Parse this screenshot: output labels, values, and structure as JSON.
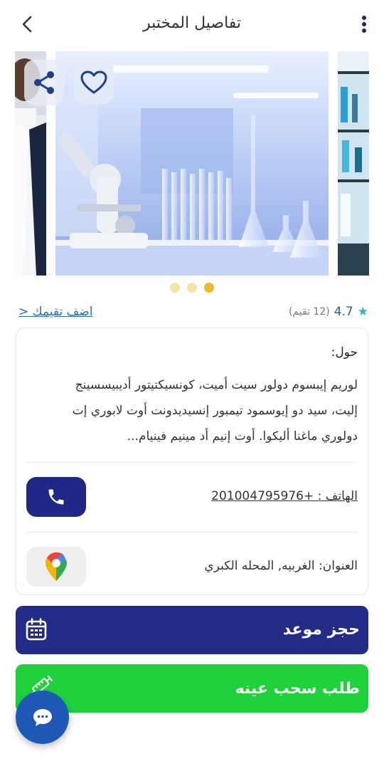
{
  "header": {
    "title": "تفاصيل المختبر",
    "back_icon": "chevron-left-icon",
    "menu_icon": "more-vertical-icon"
  },
  "gallery": {
    "image_count": 3,
    "active_index": 2,
    "images": [
      "lab-scientist-photo",
      "laboratory-equipment-photo",
      "lab-shelves-photo"
    ],
    "share_icon": "share-icon",
    "favorite_icon": "heart-icon"
  },
  "rating": {
    "value": "4.7",
    "count_text": "(12 تقيم)",
    "add_link": "اضف تقيمك <"
  },
  "details": {
    "about_label": "حول:",
    "about_lines": [
      "لوريم إيبسوم دولور سيت أميت، كونسيكتيتور أديبيسسينج",
      "إليت، سيد دو إيوسمود تيمبور إنسيديدونت أوت لابوري إت",
      "دولوري ماغنا أليكوا. أوت إنيم أد مينيم فينيام..."
    ],
    "phone_text": "الهاتف  :  +201004795976",
    "phone_icon": "phone-icon",
    "address_text": "العنوان: الغربيه, المحله الكبري",
    "map_icon": "google-maps-pin-icon"
  },
  "actions": {
    "book_label": "حجز موعد",
    "book_icon": "calendar-icon",
    "sample_label": "طلب سحب عينه",
    "sample_icon": "syringe-icon",
    "chat_icon": "chat-bubble-icon"
  },
  "colors": {
    "primary_navy": "#232b89",
    "green": "#1fd23c",
    "chat_blue": "#1f59b8",
    "star_teal": "#2ab7c2",
    "dot_active": "#f4b727",
    "dot_inactive": "#f7e3a5"
  }
}
